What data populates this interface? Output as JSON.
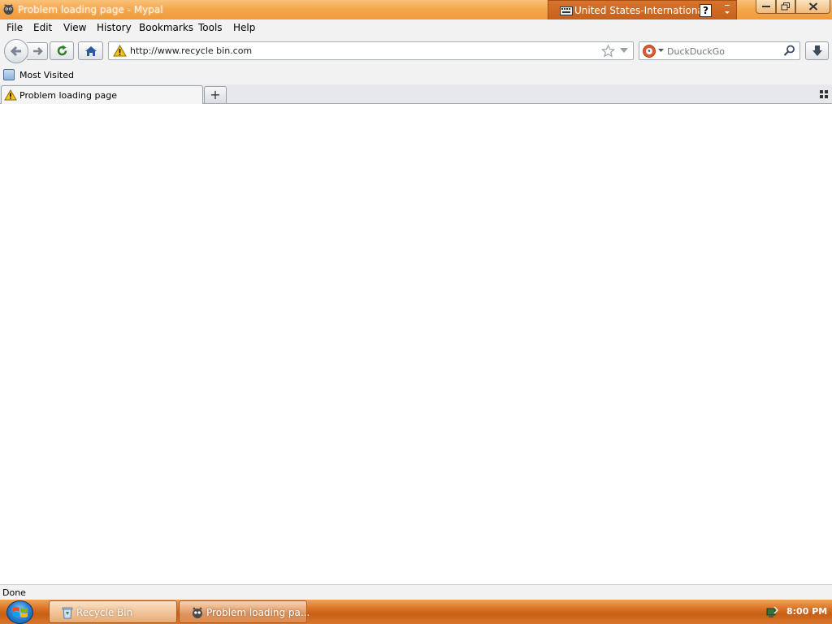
{
  "window": {
    "title": "Problem loading page - Mypal"
  },
  "language_bar": {
    "label": "United States-International",
    "help_glyph": "?"
  },
  "menu": {
    "items": [
      {
        "label": "File"
      },
      {
        "label": "Edit"
      },
      {
        "label": "View"
      },
      {
        "label": "History"
      },
      {
        "label": "Bookmarks"
      },
      {
        "label": "Tools"
      },
      {
        "label": "Help"
      }
    ]
  },
  "navigation": {
    "url": "http://www.recycle bin.com",
    "search_engine": "DuckDuckGo",
    "search_placeholder": "DuckDuckGo"
  },
  "bookmarks": {
    "items": [
      {
        "label": "Most Visited"
      }
    ]
  },
  "tabs": {
    "items": [
      {
        "label": "Problem loading page",
        "active": true
      }
    ],
    "new_tab_glyph": "+"
  },
  "status": {
    "text": "Done"
  },
  "taskbar": {
    "items": [
      {
        "label": "Recycle Bin"
      },
      {
        "label": "Problem loading pa..."
      }
    ],
    "clock": "8:00 PM"
  },
  "colors": {
    "titlebar_orange": "#f4a84e",
    "taskbar_orange": "#d86f22",
    "warning_yellow": "#f5c518"
  }
}
